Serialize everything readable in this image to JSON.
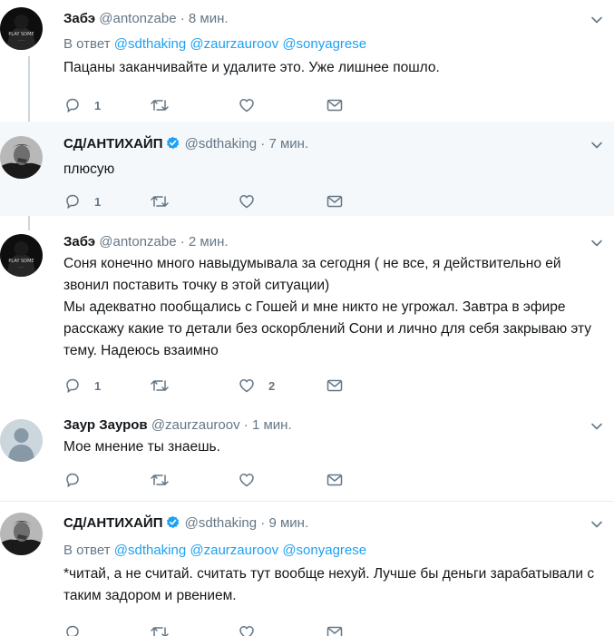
{
  "tweets": [
    {
      "name": "Забэ",
      "verified": false,
      "handle": "@antonzabe",
      "dot": "·",
      "time": "8 мин.",
      "reply_prefix": "В ответ",
      "reply_to": [
        "@sdthaking",
        "@zaurzauroov",
        "@sonyagrese"
      ],
      "paragraphs": [
        "Пацаны заканчивайте и удалите это. Уже лишнее пошло."
      ],
      "reply_count": "1",
      "retweet_count": "",
      "like_count": "",
      "avatar": "black-hoodie-avatar",
      "highlighted": false
    },
    {
      "name": "СД/АНТИХАЙП",
      "verified": true,
      "handle": "@sdthaking",
      "dot": "·",
      "time": "7 мин.",
      "reply_prefix": "",
      "reply_to": [],
      "paragraphs": [
        "плюсую"
      ],
      "reply_count": "1",
      "retweet_count": "",
      "like_count": "",
      "avatar": "man-portrait-avatar",
      "highlighted": true
    },
    {
      "name": "Забэ",
      "verified": false,
      "handle": "@antonzabe",
      "dot": "·",
      "time": "2 мин.",
      "reply_prefix": "",
      "reply_to": [],
      "paragraphs": [
        "Соня конечно много навыдумывала за сегодня ( не все, я действительно ей звонил поставить точку в этой ситуации)",
        "Мы адекватно пообщались с Гошей и мне никто не угрожал. Завтра в эфире расскажу какие то детали без оскорблений Сони и лично для себя закрываю эту тему. Надеюсь взаимно"
      ],
      "reply_count": "1",
      "retweet_count": "",
      "like_count": "2",
      "avatar": "black-hoodie-avatar",
      "highlighted": false
    },
    {
      "name": "Заур Зауров",
      "verified": false,
      "handle": "@zaurzauroov",
      "dot": "·",
      "time": "1 мин.",
      "reply_prefix": "",
      "reply_to": [],
      "paragraphs": [
        "Мое мнение ты знаешь."
      ],
      "reply_count": "",
      "retweet_count": "",
      "like_count": "",
      "avatar": "default-egg-avatar",
      "highlighted": false
    },
    {
      "name": "СД/АНТИХАЙП",
      "verified": true,
      "handle": "@sdthaking",
      "dot": "·",
      "time": "9 мин.",
      "reply_prefix": "В ответ",
      "reply_to": [
        "@sdthaking",
        "@zaurzauroov",
        "@sonyagrese"
      ],
      "paragraphs": [
        "*читай, а не считай. считать тут вообще нехуй. Лучше бы деньги зарабатывали с таким задором и рвением."
      ],
      "reply_count": "",
      "retweet_count": "",
      "like_count": "",
      "avatar": "man-portrait-avatar",
      "highlighted": false
    }
  ],
  "colors": {
    "text": "#14171a",
    "muted": "#657786",
    "link": "#1da1f2",
    "highlight_bg": "#f5f8fa",
    "divider": "#e6ecf0",
    "thread_line": "#ccd6dd"
  }
}
